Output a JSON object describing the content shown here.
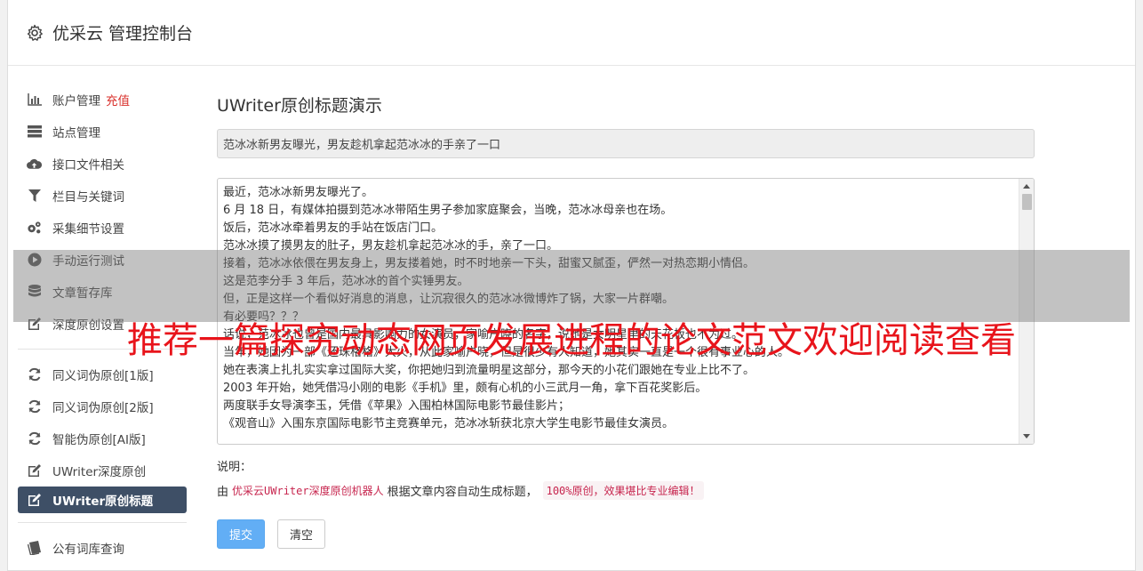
{
  "header": {
    "title": "优采云 管理控制台",
    "icon": "gear-icon"
  },
  "sidebar": {
    "groups": [
      [
        {
          "label": "账户管理",
          "extra": "充值",
          "icon": "bar-chart-icon"
        },
        {
          "label": "站点管理",
          "icon": "server-icon"
        },
        {
          "label": "接口文件相关",
          "icon": "cloud-upload-icon"
        },
        {
          "label": "栏目与关键词",
          "icon": "filter-icon"
        },
        {
          "label": "采集细节设置",
          "icon": "cogs-icon"
        },
        {
          "label": "手动运行测试",
          "icon": "play-circle-icon"
        },
        {
          "label": "文章暂存库",
          "icon": "database-icon"
        },
        {
          "label": "深度原创设置",
          "icon": "edit-icon"
        }
      ],
      [
        {
          "label": "同义词伪原创[1版]",
          "icon": "refresh-icon"
        },
        {
          "label": "同义词伪原创[2版]",
          "icon": "refresh-icon"
        },
        {
          "label": "智能伪原创[AI版]",
          "icon": "refresh-icon"
        },
        {
          "label": "UWriter深度原创",
          "icon": "edit-icon"
        },
        {
          "label": "UWriter原创标题",
          "icon": "edit-icon",
          "active": true
        }
      ],
      [
        {
          "label": "公有词库查询",
          "icon": "book-icon"
        }
      ]
    ]
  },
  "main": {
    "title": "UWriter原创标题演示",
    "title_value": "范冰冰新男友曝光，男友趁机拿起范冰冰的手亲了一口",
    "body_lines": [
      "最近，范冰冰新男友曝光了。",
      "6 月 18 日，有媒体拍摄到范冰冰带陌生男子参加家庭聚会，当晚，范冰冰母亲也在场。",
      "饭后，范冰冰牵着男友的手站在饭店门口。",
      "范冰冰摸了摸男友的肚子，男友趁机拿起范冰冰的手，亲了一口。",
      "接着，范冰冰依偎在男友身上，男友搂着她，时不时地亲一下头，甜蜜又腻歪，俨然一对热恋期小情侣。",
      "这是范李分手 3 年后，范冰冰的首个实锤男友。",
      "但，正是这样一个看似好消息的消息，让沉寂很久的范冰冰微博炸了锅，大家一片群嘲。",
      "有必要吗？？？",
      "话说，范冰冰也曾是国内最具影响力的女演员，家喻户晓的名字，说她是女明星里的天花板也不为过。",
      "当年，她因为一部《还珠格格》大火，从此家喻户晓，但是很少有人知道，她其实一直是一个很有事业心的人。",
      "她在表演上扎扎实实拿过国际大奖，你把她归到流量明星这部分，那今天的小花们跟她在专业上比不了。",
      "2003 年开始，她凭借冯小刚的电影《手机》里，颇有心机的小三武月一角，拿下百花奖影后。",
      "两度联手女导演李玉，凭借《苹果》入围柏林国际电影节最佳影片；",
      "《观音山》入围东京国际电影节主竞赛单元，范冰冰斩获北京大学生电影节最佳女演员。"
    ],
    "desc_label": "说明：",
    "desc_prefix": "由",
    "desc_pink": "优采云UWriter深度原创机器人",
    "desc_mid": "根据文章内容自动生成标题，",
    "desc_badge": "100%原创，效果堪比专业编辑！",
    "submit_label": "提交",
    "clear_label": "清空"
  },
  "banner": "推荐一篇探究动态网页发展进程的论文范文欢迎阅读查看",
  "colors": {
    "active_nav": "#3e4f66",
    "primary_button": "#62aef5",
    "banner_red": "#e8141b",
    "recharge_red": "#d9302b"
  }
}
